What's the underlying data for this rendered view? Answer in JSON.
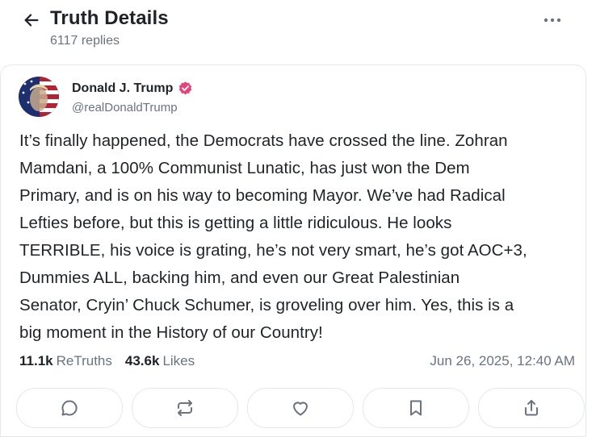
{
  "header": {
    "title": "Truth Details",
    "replies": "6117 replies"
  },
  "post": {
    "author_name": "Donald J. Trump",
    "author_handle": "@realDonaldTrump",
    "text_lines": [
      "It’s finally happened, the Democrats have crossed the line. Zohran",
      "Mamdani, a 100% Communist Lunatic, has just won the Dem",
      "Primary, and is on his way to becoming Mayor. We’ve had Radical",
      "Lefties before, but this is getting a little ridiculous. He looks",
      "TERRIBLE, his voice is grating, he’s not very smart, he’s got AOC+3,",
      "Dummies ALL, backing him, and even our Great Palestinian",
      "Senator, Cryin’ Chuck Schumer, is groveling over him. Yes, this is a",
      "big moment in the History of our Country!"
    ],
    "retruths_count": "11.1k",
    "retruths_label": "ReTruths",
    "likes_count": "43.6k",
    "likes_label": "Likes",
    "timestamp": "Jun 26, 2025, 12:40 AM"
  },
  "icons": {
    "back": "arrow-left-icon",
    "more": "more-horizontal-icon",
    "verified": "verified-badge-icon",
    "reply": "comment-icon",
    "retruth": "repost-icon",
    "like": "heart-icon",
    "bookmark": "bookmark-icon",
    "share": "share-icon"
  },
  "colors": {
    "verified": "#e5447a",
    "text": "#1f2328",
    "muted": "#6b7280",
    "border": "#e5e7eb"
  }
}
